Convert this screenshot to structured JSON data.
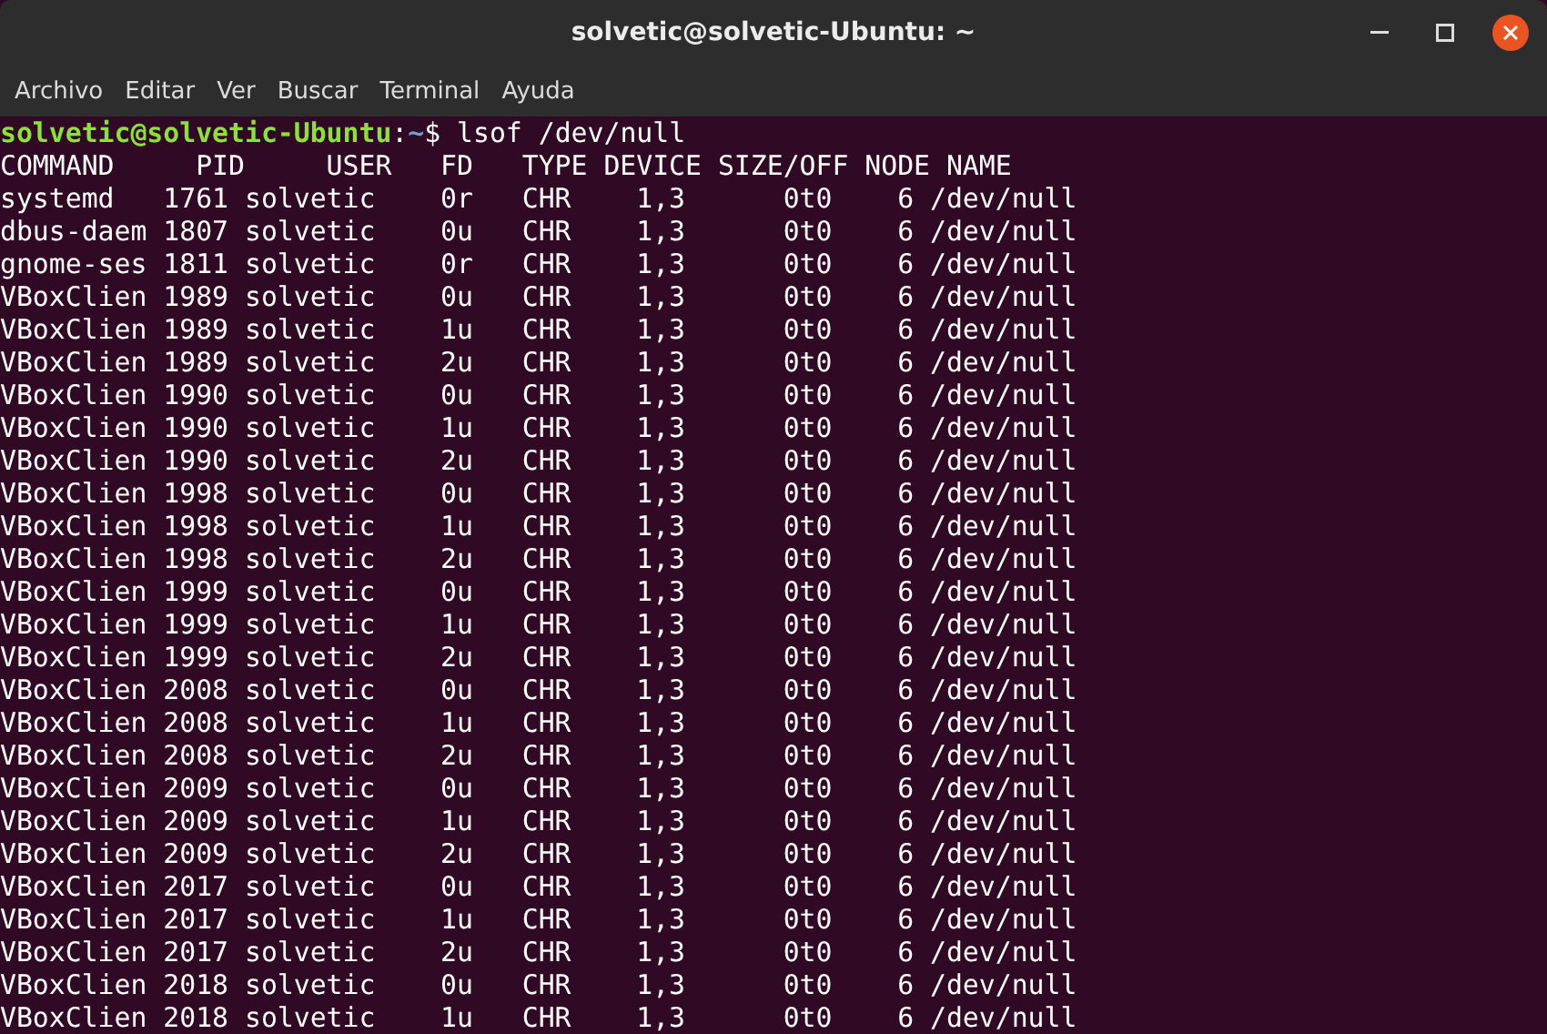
{
  "window": {
    "title": "solvetic@solvetic-Ubuntu: ~"
  },
  "menu": [
    "Archivo",
    "Editar",
    "Ver",
    "Buscar",
    "Terminal",
    "Ayuda"
  ],
  "prompt": {
    "user_host": "solvetic@solvetic-Ubuntu",
    "separator": ":",
    "path": "~",
    "symbol": "$",
    "command": "lsof /dev/null"
  },
  "header": "COMMAND     PID     USER   FD   TYPE DEVICE SIZE/OFF NODE NAME",
  "rows": [
    "systemd   1761 solvetic    0r   CHR    1,3      0t0    6 /dev/null",
    "dbus-daem 1807 solvetic    0u   CHR    1,3      0t0    6 /dev/null",
    "gnome-ses 1811 solvetic    0r   CHR    1,3      0t0    6 /dev/null",
    "VBoxClien 1989 solvetic    0u   CHR    1,3      0t0    6 /dev/null",
    "VBoxClien 1989 solvetic    1u   CHR    1,3      0t0    6 /dev/null",
    "VBoxClien 1989 solvetic    2u   CHR    1,3      0t0    6 /dev/null",
    "VBoxClien 1990 solvetic    0u   CHR    1,3      0t0    6 /dev/null",
    "VBoxClien 1990 solvetic    1u   CHR    1,3      0t0    6 /dev/null",
    "VBoxClien 1990 solvetic    2u   CHR    1,3      0t0    6 /dev/null",
    "VBoxClien 1998 solvetic    0u   CHR    1,3      0t0    6 /dev/null",
    "VBoxClien 1998 solvetic    1u   CHR    1,3      0t0    6 /dev/null",
    "VBoxClien 1998 solvetic    2u   CHR    1,3      0t0    6 /dev/null",
    "VBoxClien 1999 solvetic    0u   CHR    1,3      0t0    6 /dev/null",
    "VBoxClien 1999 solvetic    1u   CHR    1,3      0t0    6 /dev/null",
    "VBoxClien 1999 solvetic    2u   CHR    1,3      0t0    6 /dev/null",
    "VBoxClien 2008 solvetic    0u   CHR    1,3      0t0    6 /dev/null",
    "VBoxClien 2008 solvetic    1u   CHR    1,3      0t0    6 /dev/null",
    "VBoxClien 2008 solvetic    2u   CHR    1,3      0t0    6 /dev/null",
    "VBoxClien 2009 solvetic    0u   CHR    1,3      0t0    6 /dev/null",
    "VBoxClien 2009 solvetic    1u   CHR    1,3      0t0    6 /dev/null",
    "VBoxClien 2009 solvetic    2u   CHR    1,3      0t0    6 /dev/null",
    "VBoxClien 2017 solvetic    0u   CHR    1,3      0t0    6 /dev/null",
    "VBoxClien 2017 solvetic    1u   CHR    1,3      0t0    6 /dev/null",
    "VBoxClien 2017 solvetic    2u   CHR    1,3      0t0    6 /dev/null",
    "VBoxClien 2018 solvetic    0u   CHR    1,3      0t0    6 /dev/null",
    "VBoxClien 2018 solvetic    1u   CHR    1,3      0t0    6 /dev/null"
  ]
}
